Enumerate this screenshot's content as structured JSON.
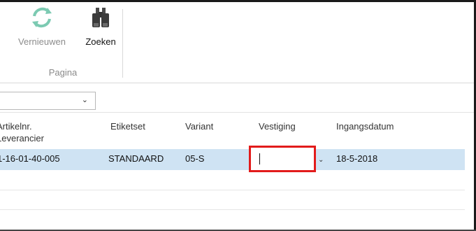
{
  "ribbon": {
    "refresh_label": "Vernieuwen",
    "search_label": "Zoeken",
    "group_label": "Pagina"
  },
  "filter": {
    "value": ""
  },
  "grid": {
    "columns": [
      "Artikelnr.\nLeverancier",
      "Etiketset",
      "Variant",
      "Vestiging",
      "Ingangsdatum"
    ],
    "rows": [
      {
        "artikelnr": "1-16-01-40-005",
        "etiketset": "STANDAARD",
        "variant": "05-S",
        "vestiging": "",
        "ingangsdatum": "18-5-2018"
      }
    ]
  },
  "colors": {
    "selected_row": "#cfe3f3",
    "highlight_border": "#e21b1b",
    "refresh_icon": "#6fc2a8"
  }
}
